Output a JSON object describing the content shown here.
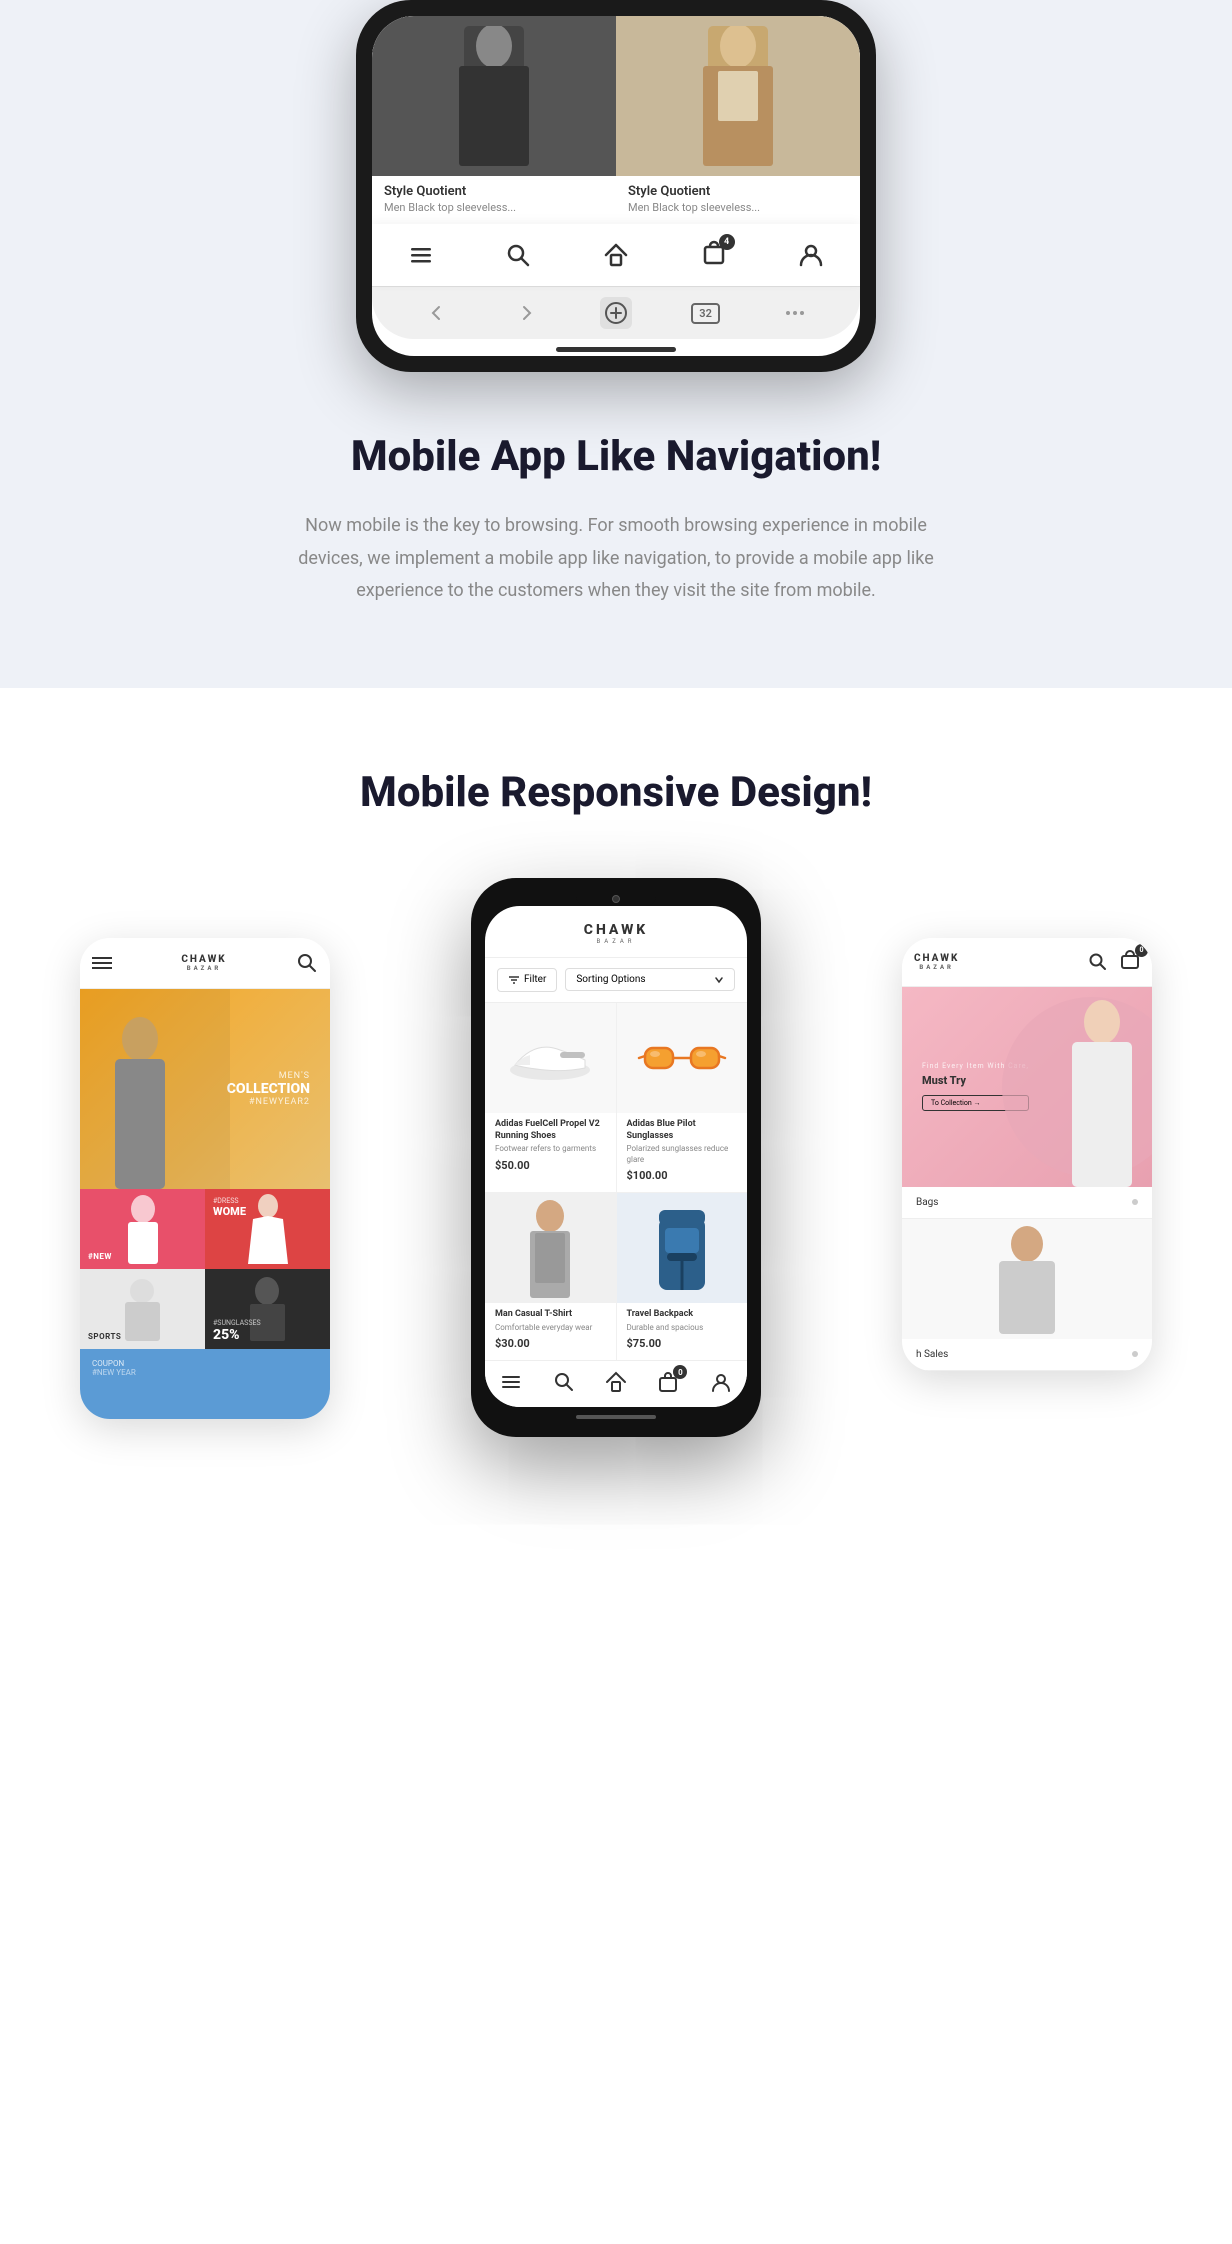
{
  "section1": {
    "title": "Mobile App Like Navigation!",
    "description": "Now mobile is the key to browsing. For smooth browsing experience in mobile devices, we implement a mobile app like navigation, to provide a mobile app like experience to the customers when they visit the site from mobile.",
    "phone": {
      "products": [
        {
          "brand": "Style Quotient",
          "desc": "Men Black top sleeveless...",
          "imgType": "dark"
        },
        {
          "brand": "Style Quotient",
          "desc": "Men Black top sleeveless...",
          "imgType": "light"
        }
      ],
      "cartBadge": "4",
      "tabCount": "32"
    }
  },
  "section2": {
    "title": "Mobile Responsive Design!",
    "centerPhone": {
      "brand": "CHAWK",
      "brandSub": "BAZAR",
      "filterLabel": "Filter",
      "sortLabel": "Sorting Options",
      "products": [
        {
          "name": "Adidas FuelCell Propel V2 Running Shoes",
          "desc": "Footwear refers to garments",
          "price": "$50.00",
          "imgType": "shoe"
        },
        {
          "name": "Adidas Blue Pilot Sunglasses",
          "desc": "Polarized sunglasses reduce glare",
          "price": "$100.00",
          "imgType": "sunglasses"
        },
        {
          "name": "Man Casual T-Shirt",
          "desc": "Comfortable everyday wear",
          "price": "$30.00",
          "imgType": "person"
        },
        {
          "name": "Travel Backpack",
          "desc": "Durable and spacious",
          "price": "$75.00",
          "imgType": "backpack"
        }
      ]
    },
    "leftPhone": {
      "brand": "CHAWK",
      "brandSub": "BAZAR",
      "categories": [
        {
          "label": "MEN'S COLLECTION",
          "tag": "#NEWYEAR2",
          "bg": "orange"
        },
        {
          "label": "#NEW",
          "bg": "pink"
        },
        {
          "label": "#DRESS WOMEN",
          "bg": "pink2"
        },
        {
          "label": "SPORTS",
          "bg": "sports"
        },
        {
          "label": "#SUNGLASSES 25%",
          "bg": "sunglasses",
          "discount": "25%"
        },
        {
          "label": "COUPO #NEW YEAR",
          "bg": "coupon"
        }
      ]
    },
    "rightPhone": {
      "brand": "CHAWK",
      "brandSub": "BAZAR",
      "heroText": "Find Every Item With Care, Must Try",
      "heroCta": "To Collection →",
      "categories": [
        "Bags",
        "h Sales"
      ],
      "cartBadge": "0"
    }
  }
}
